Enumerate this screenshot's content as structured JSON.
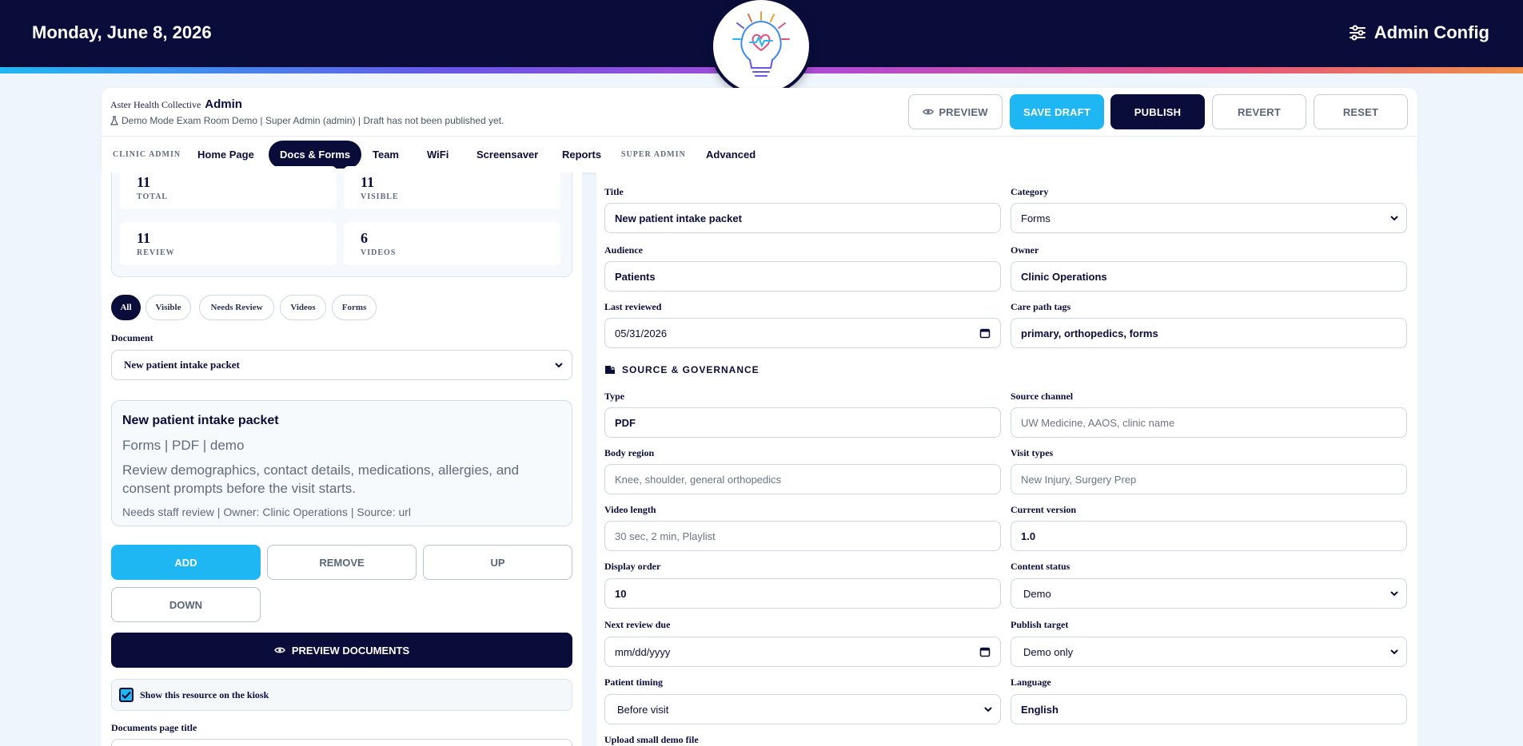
{
  "topbar": {
    "date": "Monday, June 8, 2026",
    "config_label": "Admin Config"
  },
  "header": {
    "org": "Aster Health Collective",
    "role": "Admin",
    "mode_line": "Demo Mode Exam Room Demo | Super Admin (admin) | Draft has not been published yet.",
    "buttons": {
      "preview": "PREVIEW",
      "save_draft": "SAVE DRAFT",
      "publish": "PUBLISH",
      "revert": "REVERT",
      "reset": "RESET"
    }
  },
  "nav": {
    "clinic_section": "CLINIC ADMIN",
    "home": "Home Page",
    "docs": "Docs & Forms",
    "team": "Team",
    "wifi": "WiFi",
    "screensaver": "Screensaver",
    "reports": "Reports",
    "super_section": "SUPER ADMIN",
    "advanced": "Advanced"
  },
  "stats": [
    {
      "value": "11",
      "label": "TOTAL"
    },
    {
      "value": "11",
      "label": "VISIBLE"
    },
    {
      "value": "11",
      "label": "REVIEW"
    },
    {
      "value": "6",
      "label": "VIDEOS"
    }
  ],
  "filters": {
    "all": "All",
    "visible": "Visible",
    "needs_review": "Needs Review",
    "videos": "Videos",
    "forms": "Forms"
  },
  "document": {
    "label": "Document",
    "selected": "New patient intake packet",
    "card_title": "New patient intake packet",
    "card_meta": "Forms | PDF | demo",
    "card_desc": "Review demographics, contact details, medications, allergies, and consent prompts before the visit starts.",
    "card_status": "Needs staff review | Owner: Clinic Operations | Source: url"
  },
  "actions": {
    "add": "ADD",
    "remove": "REMOVE",
    "up": "UP",
    "down": "DOWN",
    "preview_docs": "PREVIEW DOCUMENTS"
  },
  "kiosk_checkbox": "Show this resource on the kiosk",
  "docs_page_title_label": "Documents page title",
  "form": {
    "title": {
      "label": "Title",
      "value": "New patient intake packet"
    },
    "category": {
      "label": "Category",
      "value": "Forms"
    },
    "audience": {
      "label": "Audience",
      "value": "Patients"
    },
    "owner": {
      "label": "Owner",
      "value": "Clinic Operations"
    },
    "last_reviewed": {
      "label": "Last reviewed",
      "value": "05/31/2026"
    },
    "care_tags": {
      "label": "Care path tags",
      "value": "primary, orthopedics, forms"
    },
    "section": "SOURCE & GOVERNANCE",
    "type": {
      "label": "Type",
      "value": "PDF"
    },
    "source_channel": {
      "label": "Source channel",
      "placeholder": "UW Medicine, AAOS, clinic name"
    },
    "body_region": {
      "label": "Body region",
      "placeholder": "Knee, shoulder, general orthopedics"
    },
    "visit_types": {
      "label": "Visit types",
      "placeholder": "New Injury, Surgery Prep"
    },
    "video_length": {
      "label": "Video length",
      "placeholder": "30 sec, 2 min, Playlist"
    },
    "current_version": {
      "label": "Current version",
      "value": "1.0"
    },
    "display_order": {
      "label": "Display order",
      "value": "10"
    },
    "content_status": {
      "label": "Content status",
      "value": "Demo"
    },
    "next_review": {
      "label": "Next review due",
      "placeholder": "mm/dd/yyyy"
    },
    "publish_target": {
      "label": "Publish target",
      "value": "Demo only"
    },
    "patient_timing": {
      "label": "Patient timing",
      "value": "Before visit"
    },
    "language": {
      "label": "Language",
      "value": "English"
    },
    "upload": {
      "label": "Upload small demo file"
    }
  }
}
